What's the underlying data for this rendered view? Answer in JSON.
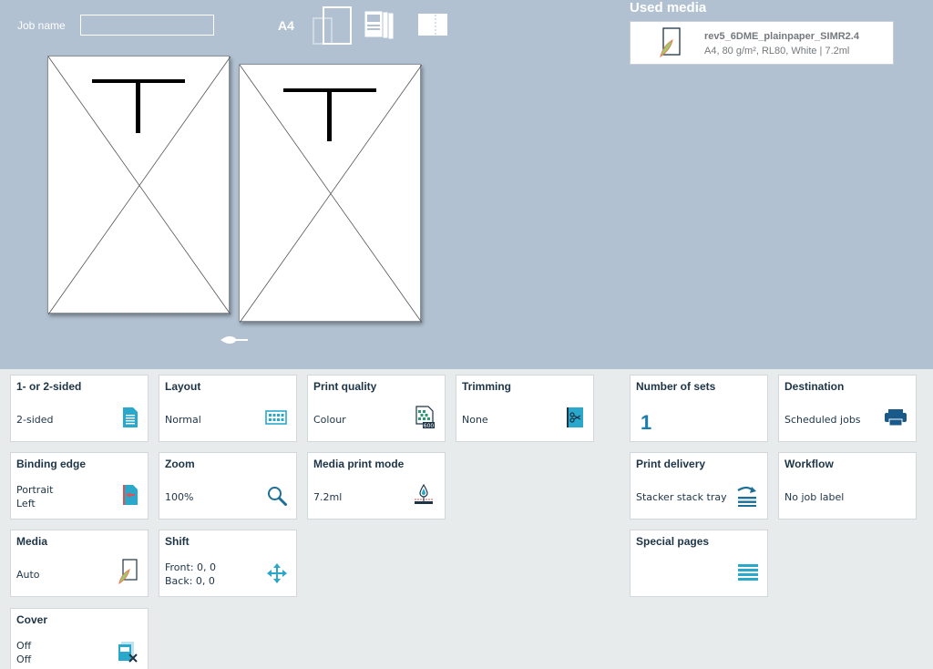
{
  "job": {
    "name_label": "Job name",
    "name_value": "",
    "paper_size": "A4"
  },
  "used_media": {
    "title": "Used media",
    "name": "rev5_6DME_plainpaper_SIMR2.4",
    "description": "A4, 80 g/m², RL80, White | 7.2ml"
  },
  "preview": {
    "pages": [
      {
        "letter": "T"
      },
      {
        "letter": "T"
      }
    ]
  },
  "tiles": {
    "sided": {
      "title": "1- or 2-sided",
      "value": "2-sided"
    },
    "layout": {
      "title": "Layout",
      "value": "Normal"
    },
    "print_quality": {
      "title": "Print quality",
      "value": "Colour"
    },
    "trimming": {
      "title": "Trimming",
      "value": "None"
    },
    "number_of_sets": {
      "title": "Number of sets",
      "value": "1"
    },
    "destination": {
      "title": "Destination",
      "value": "Scheduled jobs"
    },
    "binding_edge": {
      "title": "Binding edge",
      "value_line1": "Portrait",
      "value_line2": "Left"
    },
    "zoom": {
      "title": "Zoom",
      "value": "100%"
    },
    "media_print_mode": {
      "title": "Media print mode",
      "value": "7.2ml"
    },
    "print_delivery": {
      "title": "Print delivery",
      "value": "Stacker stack tray"
    },
    "workflow": {
      "title": "Workflow",
      "value": "No job label"
    },
    "media": {
      "title": "Media",
      "value": "Auto"
    },
    "shift": {
      "title": "Shift",
      "value_line1": "Front: 0, 0",
      "value_line2": "Back: 0, 0"
    },
    "special_pages": {
      "title": "Special pages"
    },
    "cover": {
      "title": "Cover",
      "value_line1": "Off",
      "value_line2": "Off"
    }
  },
  "icons": {
    "sided": "document-icon",
    "layout": "layout-grid-icon",
    "print_quality": "print-quality-icon",
    "trimming": "scissors-icon",
    "destination": "printer-icon",
    "binding_edge": "binding-edge-icon",
    "zoom": "magnifier-icon",
    "media_print_mode": "ink-drop-icon",
    "print_delivery": "stacker-icon",
    "media": "media-sheet-icon",
    "shift": "move-arrows-icon",
    "special_pages": "list-lines-icon",
    "cover": "cover-icon"
  },
  "colors": {
    "preview_bg": "#b1c1d1",
    "panel_bg": "#e8ebeb",
    "accent": "#1a7dad",
    "icon_teal": "#2aa8cc",
    "text_dark": "#1d3447"
  }
}
